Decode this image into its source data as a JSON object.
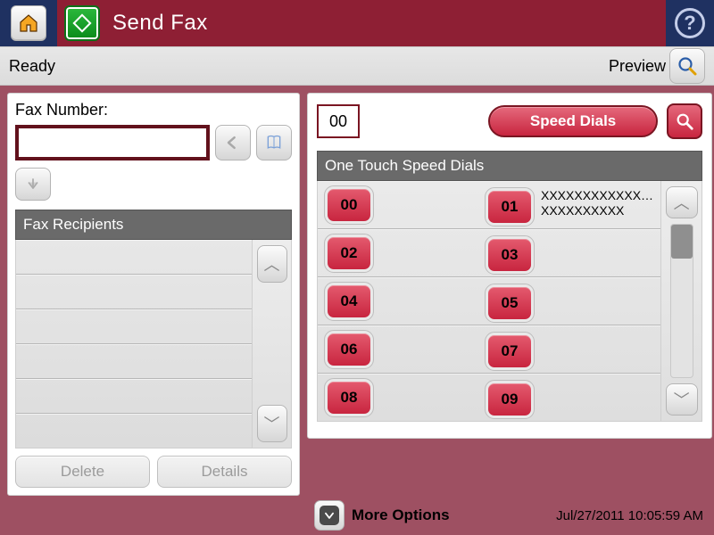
{
  "titlebar": {
    "title": "Send Fax"
  },
  "statusbar": {
    "status": "Ready",
    "preview_label": "Preview"
  },
  "left_panel": {
    "fax_number_label": "Fax Number:",
    "fax_number_value": "",
    "recipients_header": "Fax Recipients",
    "delete_label": "Delete",
    "details_label": "Details"
  },
  "right_panel": {
    "sd_code": "00",
    "speed_dials_label": "Speed Dials",
    "one_touch_header": "One Touch Speed Dials",
    "entries": [
      {
        "left": "00",
        "right": "01",
        "right_line1": "XXXXXXXXXXXX…",
        "right_line2": "XXXXXXXXXX"
      },
      {
        "left": "02",
        "right": "03",
        "right_line1": "",
        "right_line2": ""
      },
      {
        "left": "04",
        "right": "05",
        "right_line1": "",
        "right_line2": ""
      },
      {
        "left": "06",
        "right": "07",
        "right_line1": "",
        "right_line2": ""
      },
      {
        "left": "08",
        "right": "09",
        "right_line1": "",
        "right_line2": ""
      }
    ]
  },
  "footer": {
    "more_options_label": "More Options",
    "timestamp": "Jul/27/2011 10:05:59 AM"
  }
}
